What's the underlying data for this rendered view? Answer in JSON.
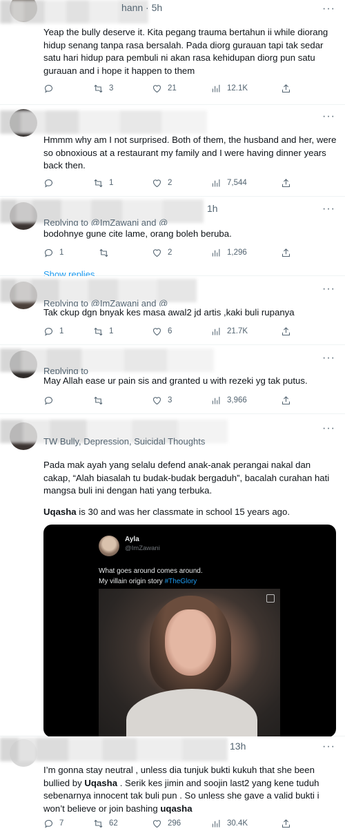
{
  "tweets": [
    {
      "time": "hann · 5h",
      "text": "Yeap the bully deserve it. Kita pegang trauma bertahun ii while diorang hidup senang tanpa rasa bersalah. Pada diorg gurauan tapi tak sedar satu hari hidup para pembuli ni akan rasa kehidupan diorg pun satu gurauan and i hope it happen to them",
      "replies": "",
      "retweets": "3",
      "likes": "21",
      "views": "12.1K"
    },
    {
      "text": "Hmmm why am I not surprised. Both of them, the husband and her, were so obnoxious at a restaurant my family and I were having dinner years back then.",
      "replies": "",
      "retweets": "1",
      "likes": "2",
      "views": "7,544"
    },
    {
      "time": "1h",
      "replying": "Replying to @ImZawani and @",
      "text": "bodohnye gune cite lame, orang boleh beruba.",
      "replies": "1",
      "retweets": "",
      "likes": "2",
      "views": "1,296",
      "show_replies": "Show replies"
    },
    {
      "replying": "Replying to @ImZawani and @",
      "text": "Tak ckup dgn bnyak kes masa awal2 jd artis ,kaki buli rupanya",
      "replies": "1",
      "retweets": "1",
      "likes": "6",
      "views": "21.7K"
    },
    {
      "replying": "Replying to",
      "text": "May Allah ease ur pain sis and granted u with rezeki yg tak putus.",
      "replies": "",
      "retweets": "",
      "likes": "3",
      "views": "3,966"
    },
    {
      "tw_label": "TW Bully, Depression, Suicidal Thoughts",
      "para1": "Pada mak ayah yang selalu defend anak-anak perangai nakal dan cakap, “Alah biasalah tu budak-budak bergaduh”, bacalah curahan hati mangsa buli ini dengan hati yang terbuka.",
      "para2_name": "Uqasha",
      "para2_rest": " is 30 and was her classmate in school 15 years ago.",
      "embed": {
        "name": "Ayla",
        "handle": "@ImZawani",
        "line1": "What goes around comes around.",
        "line2_prefix": "My villain origin story ",
        "line2_tag": "#TheGlory"
      }
    },
    {
      "time": "13h",
      "text_a": "I’m gonna stay neutral , unless dia tunjuk bukti kukuh that she been bullied by ",
      "text_name1": "Uqasha",
      "text_b": " . Serik kes jimin and soojin last2 yang kene tuduh sebenarnya innocent tak buli pun . So unless she gave a valid bukti i won’t believe or join bashing ",
      "text_name2": "uqasha",
      "replies": "7",
      "retweets": "62",
      "likes": "296",
      "views": "30.4K"
    }
  ],
  "icons": {
    "reply": "reply-icon",
    "retweet": "retweet-icon",
    "like": "heart-icon",
    "views": "views-icon",
    "share": "share-icon",
    "more": "more-icon"
  },
  "more_label": "···",
  "colors": {
    "link": "#1d9bf0",
    "muted": "#536471",
    "text": "#0f1419"
  }
}
